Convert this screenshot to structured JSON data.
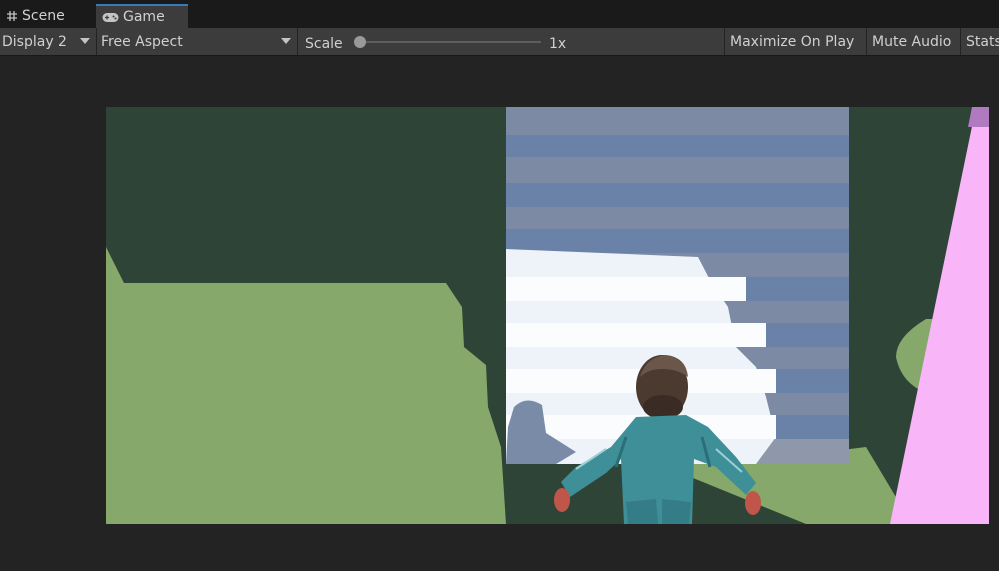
{
  "tabs": [
    {
      "label": "Scene",
      "icon": "hash-grid-icon"
    },
    {
      "label": "Game",
      "icon": "gamepad-icon"
    }
  ],
  "toolbar": {
    "display": "Display 2",
    "aspect": "Free Aspect",
    "scale_label": "Scale",
    "scale_value": "1x",
    "scale_fraction": 0.0,
    "maximize_on_play": "Maximize On Play",
    "mute_audio": "Mute Audio",
    "stats": "Stats"
  },
  "colors": {
    "panel_bg": "#232323",
    "toolbar_bg": "#3c3c3c",
    "tab_accent": "#3a79bb",
    "ground_green": "#86a86a",
    "shadow_green": "#2e4436",
    "stairs_blue": "#6a81a8",
    "stairs_white": "#f2f6fa",
    "pink_plane": "#f8b6f8",
    "character_teal": "#3f8f98"
  }
}
